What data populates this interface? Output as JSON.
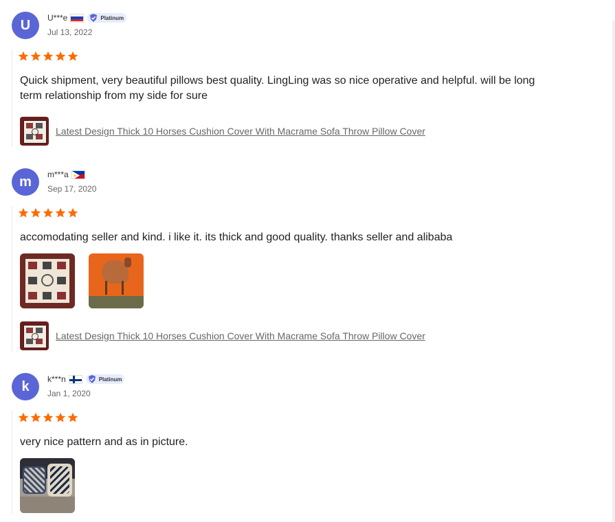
{
  "reviews": [
    {
      "avatar_letter": "U",
      "avatar_color": "#5a66d6",
      "username": "U***e",
      "country_flag": "russia-flag",
      "badge": "Platinum",
      "date": "Jul 13, 2022",
      "rating": 5,
      "text": "Quick shipment, very beautiful pillows best quality. LingLing was so nice operative and helpful. will be long term relationship from my side for sure",
      "product_name": "Latest Design Thick 10 Horses Cushion Cover With Macrame Sofa Throw Pillow Cover"
    },
    {
      "avatar_letter": "m",
      "avatar_color": "#5a66d6",
      "username": "m***a",
      "country_flag": "philippines-flag",
      "date": "Sep 17, 2020",
      "rating": 5,
      "text": "accomodating seller and kind. i like it. its thick and good quality. thanks seller and alibaba",
      "photos": [
        "horse-pattern-pillow-photo",
        "orange-horse-pillow-photo"
      ],
      "product_name": "Latest Design Thick 10 Horses Cushion Cover With Macrame Sofa Throw Pillow Cover"
    },
    {
      "avatar_letter": "k",
      "avatar_color": "#5a66d6",
      "username": "k***n",
      "country_flag": "finland-flag",
      "badge": "Platinum",
      "date": "Jan 1, 2020",
      "rating": 5,
      "text": "very nice pattern and as in picture.",
      "photos": [
        "patterned-pillows-on-sofa-photo"
      ]
    }
  ],
  "colors": {
    "star": "#ff6a00",
    "badge_bg": "#e7edff",
    "badge_icon": "#5a66d6",
    "link_text": "#666666"
  }
}
